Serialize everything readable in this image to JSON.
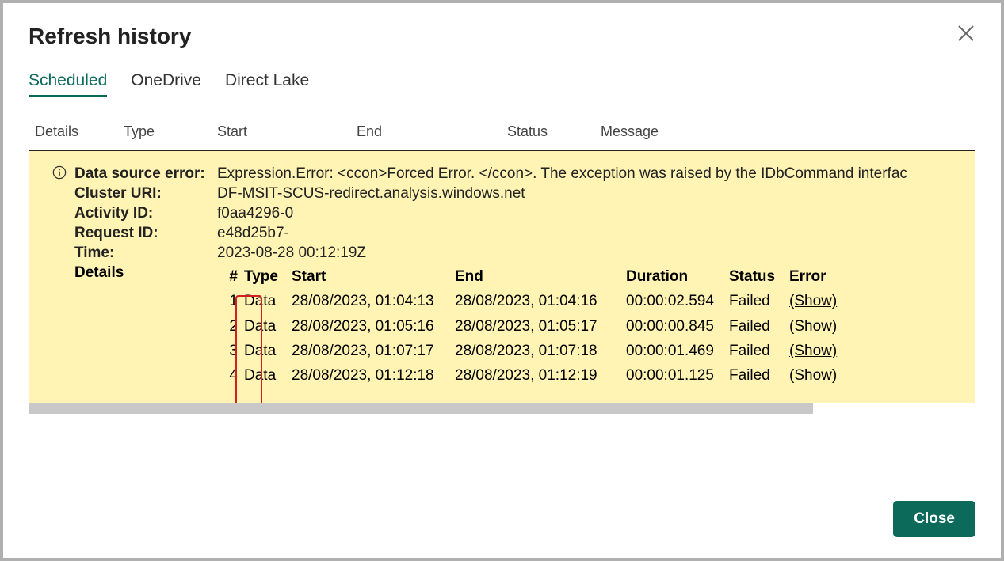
{
  "dialog": {
    "title": "Refresh history",
    "closeLabel": "Close"
  },
  "tabs": [
    {
      "label": "Scheduled",
      "active": true
    },
    {
      "label": "OneDrive",
      "active": false
    },
    {
      "label": "Direct Lake",
      "active": false
    }
  ],
  "columns": {
    "details": "Details",
    "type": "Type",
    "start": "Start",
    "end": "End",
    "status": "Status",
    "message": "Message"
  },
  "error": {
    "fields": {
      "dataSourceError": {
        "label": "Data source error:",
        "value": "Expression.Error: <ccon>Forced Error. </ccon>. The exception was raised by the IDbCommand interfac"
      },
      "clusterUri": {
        "label": "Cluster URI:",
        "value": "DF-MSIT-SCUS-redirect.analysis.windows.net"
      },
      "activityId": {
        "label": "Activity ID:",
        "value": "f0aa4296-0"
      },
      "requestId": {
        "label": "Request ID:",
        "value": "e48d25b7-"
      },
      "time": {
        "label": "Time:",
        "value": "2023-08-28 00:12:19Z"
      }
    },
    "detailsLabel": "Details",
    "detailHeaders": {
      "num": "#",
      "type": "Type",
      "start": "Start",
      "end": "End",
      "duration": "Duration",
      "status": "Status",
      "error": "Error"
    },
    "detailRows": [
      {
        "num": "1",
        "type": "Data",
        "start": "28/08/2023, 01:04:13",
        "end": "28/08/2023, 01:04:16",
        "duration": "00:00:02.594",
        "status": "Failed",
        "error": "(Show)"
      },
      {
        "num": "2",
        "type": "Data",
        "start": "28/08/2023, 01:05:16",
        "end": "28/08/2023, 01:05:17",
        "duration": "00:00:00.845",
        "status": "Failed",
        "error": "(Show)"
      },
      {
        "num": "3",
        "type": "Data",
        "start": "28/08/2023, 01:07:17",
        "end": "28/08/2023, 01:07:18",
        "duration": "00:00:01.469",
        "status": "Failed",
        "error": "(Show)"
      },
      {
        "num": "4",
        "type": "Data",
        "start": "28/08/2023, 01:12:18",
        "end": "28/08/2023, 01:12:19",
        "duration": "00:00:01.125",
        "status": "Failed",
        "error": "(Show)"
      }
    ]
  }
}
